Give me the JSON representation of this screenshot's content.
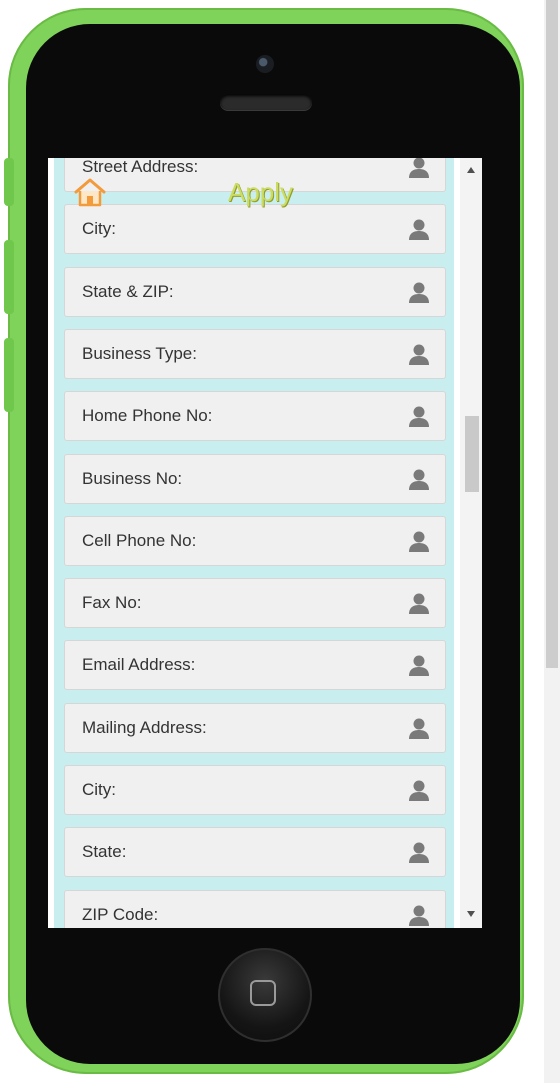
{
  "header": {
    "title": "Apply",
    "home_icon": "home-icon",
    "title_color": "#cbdc60"
  },
  "form": {
    "fields": [
      {
        "label": "Street Address:"
      },
      {
        "label": "City:"
      },
      {
        "label": "State & ZIP:"
      },
      {
        "label": "Business Type:"
      },
      {
        "label": "Home Phone No:"
      },
      {
        "label": "Business No:"
      },
      {
        "label": "Cell Phone No:"
      },
      {
        "label": "Fax No:"
      },
      {
        "label": "Email Address:"
      },
      {
        "label": "Mailing Address:"
      },
      {
        "label": "City:"
      },
      {
        "label": "State:"
      },
      {
        "label": "ZIP Code:"
      }
    ],
    "field_icon": "user-icon"
  },
  "colors": {
    "phone_body": "#7fd25a",
    "panel_background": "#c8eef0",
    "home_icon": "#f39a3b"
  }
}
